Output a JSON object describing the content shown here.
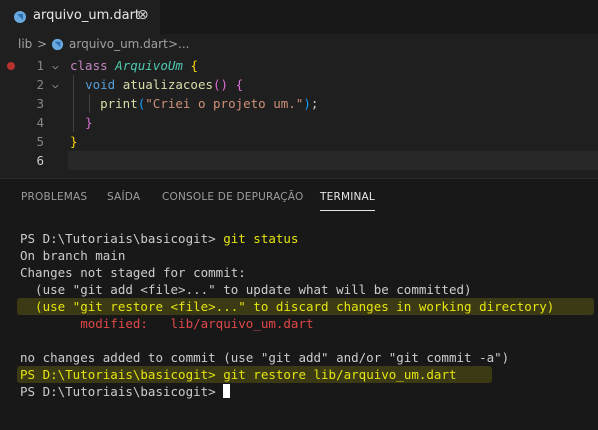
{
  "tab": {
    "filename": "arquivo_um.dart",
    "close": "⊗"
  },
  "breadcrumb": {
    "folder": "lib",
    "sep1": ">",
    "file": "arquivo_um.dart",
    "sep2": ">",
    "more": "..."
  },
  "editor": {
    "lines": [
      {
        "num": "1",
        "kw": "class",
        "cls": "ArquivoUm",
        "open": "{"
      },
      {
        "num": "2",
        "type": "void",
        "fn": "atualizacoes",
        "parens": "()",
        "open": "{"
      },
      {
        "num": "3",
        "fn": "print",
        "po": "(",
        "str": "\"Criei o projeto um.\"",
        "pc": ")",
        "semi": ";"
      },
      {
        "num": "4",
        "close": "}"
      },
      {
        "num": "5",
        "close": "}"
      },
      {
        "num": "6"
      }
    ]
  },
  "panel": {
    "tabs": [
      "PROBLEMAS",
      "SAÍDA",
      "CONSOLE DE DEPURAÇÃO",
      "TERMINAL"
    ],
    "active_tab": "TERMINAL"
  },
  "terminal": {
    "prompt": "PS D:\\Tutoriais\\basicogit>",
    "cmd1": "git status",
    "l2": "On branch main",
    "l3": "Changes not staged for commit:",
    "l4": "  (use \"git add <file>...\" to update what will be committed)",
    "l5": "  (use \"git restore <file>...\" to discard changes in working directory)",
    "l6_label": "        modified:   ",
    "l6_file": "lib/arquivo_um.dart",
    "l8": "no changes added to commit (use \"git add\" and/or \"git commit -a\")",
    "cmd2": "git restore lib/arquivo_um.dart"
  },
  "colors": {
    "terminal_yellow": "#e5e510",
    "terminal_red": "#e04848",
    "highlight": "#3b3a14",
    "breakpoint": "#b83030"
  },
  "icons": {
    "file_icon": "dart-file-icon"
  }
}
